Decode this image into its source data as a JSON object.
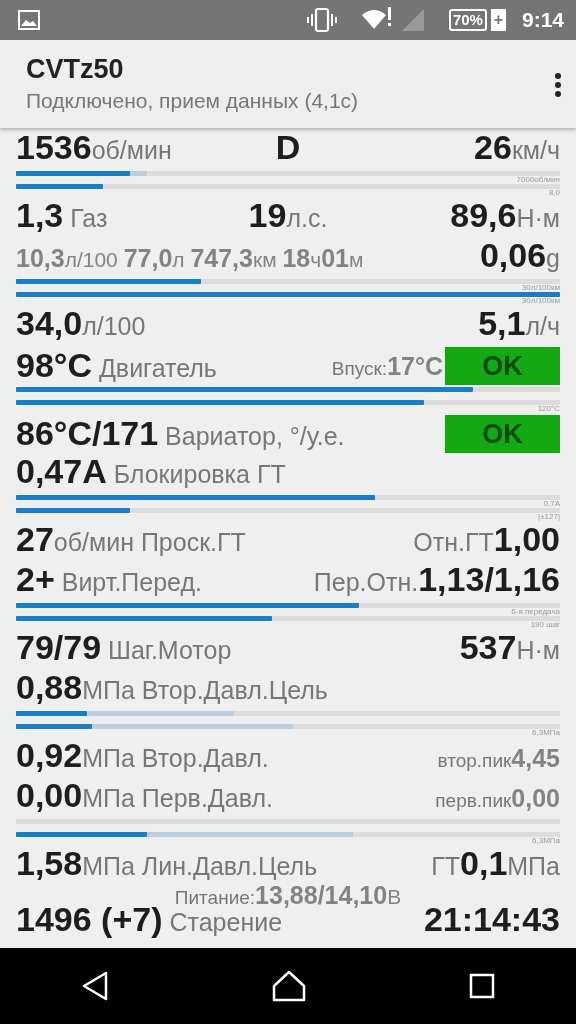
{
  "status_bar": {
    "battery": "70%",
    "battery_plus": "+",
    "time": "9:14"
  },
  "app_bar": {
    "title": "CVTz50",
    "subtitle": "Подключено, прием данных (4,1с)"
  },
  "rows": [
    {
      "kind": "line",
      "left": [
        {
          "kind": "value",
          "text": "1536"
        },
        {
          "kind": "unit",
          "text": "об/мин"
        }
      ],
      "center": [
        {
          "kind": "value",
          "text": "D"
        }
      ],
      "right": [
        {
          "kind": "value",
          "text": "26"
        },
        {
          "kind": "unit",
          "text": "км/ч"
        }
      ]
    },
    {
      "kind": "bars",
      "bars": [
        {
          "level": 0.21,
          "secondary": {
            "level": 0.24
          },
          "caption": "7000об/мин"
        },
        {
          "level": 0.16,
          "caption": "8,0"
        }
      ]
    },
    {
      "kind": "line",
      "left": [
        {
          "kind": "value",
          "text": "1,3"
        },
        {
          "kind": "unit",
          "text": " Газ"
        }
      ],
      "center": [
        {
          "kind": "value",
          "text": "19"
        },
        {
          "kind": "unit",
          "text": "л.с."
        }
      ],
      "right": [
        {
          "kind": "value",
          "text": "89,6"
        },
        {
          "kind": "unit",
          "text": "Н·м"
        }
      ]
    },
    {
      "kind": "line",
      "left": [
        {
          "kind": "gvalue",
          "text": "10,3"
        },
        {
          "kind": "sunit",
          "text": "л/100 "
        },
        {
          "kind": "gvalue",
          "text": "77,0"
        },
        {
          "kind": "sunit",
          "text": "л "
        },
        {
          "kind": "gvalue",
          "text": "747,3"
        },
        {
          "kind": "sunit",
          "text": "км "
        },
        {
          "kind": "gvalue",
          "text": "18"
        },
        {
          "kind": "sunit",
          "text": "ч"
        },
        {
          "kind": "gvalue",
          "text": "01"
        },
        {
          "kind": "sunit",
          "text": "м"
        }
      ],
      "right": [
        {
          "kind": "value",
          "text": "0,06"
        },
        {
          "kind": "unit",
          "text": "g"
        }
      ]
    },
    {
      "kind": "bars",
      "bars": [
        {
          "level": 0.34,
          "caption": "30л/100км"
        },
        {
          "level": 1.0,
          "caption": "30л/100км"
        }
      ]
    },
    {
      "kind": "line",
      "left": [
        {
          "kind": "value",
          "text": "34,0"
        },
        {
          "kind": "unit",
          "text": "л/100"
        }
      ],
      "right": [
        {
          "kind": "value",
          "text": "5,1"
        },
        {
          "kind": "unit",
          "text": "л/ч"
        }
      ]
    },
    {
      "kind": "line",
      "left": [
        {
          "kind": "value",
          "text": "98°C"
        },
        {
          "kind": "unit",
          "text": " Двигатель"
        }
      ],
      "right": [
        {
          "kind": "label",
          "text": "Впуск: "
        },
        {
          "kind": "gvalue",
          "text": "17°C"
        }
      ],
      "badge": {
        "text": "OK",
        "color": "#14a814"
      }
    },
    {
      "kind": "bars",
      "bars": [
        {
          "level": 0.84
        },
        {
          "level": 0.75,
          "caption": "120°C"
        }
      ]
    },
    {
      "kind": "line",
      "left": [
        {
          "kind": "value",
          "text": "86°C/171"
        },
        {
          "kind": "unit",
          "text": " Вариатор, °/у.е."
        }
      ],
      "badge": {
        "text": "OK",
        "color": "#14a814"
      }
    },
    {
      "kind": "line",
      "left": [
        {
          "kind": "value",
          "text": "0,47A"
        },
        {
          "kind": "unit",
          "text": " Блокировка ГТ"
        }
      ]
    },
    {
      "kind": "bars",
      "bars": [
        {
          "level": 0.66,
          "caption": "0,7A"
        },
        {
          "level": 0.21,
          "caption": "|±127|"
        }
      ]
    },
    {
      "kind": "line",
      "left": [
        {
          "kind": "value",
          "text": "27"
        },
        {
          "kind": "unit",
          "text": "об/мин Проск.ГТ"
        }
      ],
      "right": [
        {
          "kind": "unit",
          "text": "Отн.ГТ "
        },
        {
          "kind": "value",
          "text": "1,00"
        }
      ]
    },
    {
      "kind": "line",
      "left": [
        {
          "kind": "value",
          "text": "2+"
        },
        {
          "kind": "unit",
          "text": " Вирт.Перед."
        }
      ],
      "right": [
        {
          "kind": "unit",
          "text": "Пер.Отн."
        },
        {
          "kind": "value",
          "text": "1,13/1,16"
        }
      ]
    },
    {
      "kind": "bars",
      "bars": [
        {
          "level": 0.63,
          "caption": "6-я передача"
        },
        {
          "level": 0.47,
          "caption": "190 шаг"
        }
      ]
    },
    {
      "kind": "line",
      "left": [
        {
          "kind": "value",
          "text": "79/79"
        },
        {
          "kind": "unit",
          "text": " Шаг.Мотор"
        }
      ],
      "right": [
        {
          "kind": "value",
          "text": "537"
        },
        {
          "kind": "unit",
          "text": "Н·м"
        }
      ]
    },
    {
      "kind": "line",
      "left": [
        {
          "kind": "value",
          "text": "0,88"
        },
        {
          "kind": "unit",
          "text": "МПа Втор.Давл.Цель"
        }
      ]
    },
    {
      "kind": "bars",
      "bars": [
        {
          "level": 0.13,
          "secondary": {
            "level": 0.4
          }
        },
        {
          "level": 0.14,
          "secondary": {
            "level": 0.51
          },
          "caption": "6,3МПа"
        }
      ]
    },
    {
      "kind": "line",
      "left": [
        {
          "kind": "value",
          "text": "0,92"
        },
        {
          "kind": "unit",
          "text": "МПа Втор.Давл."
        }
      ],
      "right": [
        {
          "kind": "label",
          "text": "втор.пик "
        },
        {
          "kind": "gvalue",
          "text": "4,45"
        }
      ]
    },
    {
      "kind": "line",
      "left": [
        {
          "kind": "value",
          "text": "0,00"
        },
        {
          "kind": "unit",
          "text": "МПа Перв.Давл."
        }
      ],
      "right": [
        {
          "kind": "label",
          "text": "перв.пик "
        },
        {
          "kind": "gvalue",
          "text": "0,00"
        }
      ]
    },
    {
      "kind": "bars",
      "bars": [
        {
          "kind": "empty_track"
        },
        {
          "kind": "meter",
          "level": 0.24,
          "secondary": {
            "level": 0.62
          },
          "caption": "6,3МПа"
        }
      ]
    },
    {
      "kind": "line",
      "left": [
        {
          "kind": "value",
          "text": "1,58"
        },
        {
          "kind": "unit",
          "text": "МПа Лин.Давл.Цель"
        }
      ],
      "right": [
        {
          "kind": "unit",
          "text": "ГТ "
        },
        {
          "kind": "value",
          "text": "0,1"
        },
        {
          "kind": "unit",
          "text": "МПа"
        }
      ]
    },
    {
      "kind": "small",
      "center": [
        {
          "kind": "label",
          "text": "Питание:"
        },
        {
          "kind": "gvalue",
          "text": "13,88/14,10"
        },
        {
          "kind": "sunit",
          "text": "В"
        }
      ]
    },
    {
      "kind": "line",
      "left": [
        {
          "kind": "value",
          "text": "1496 (+7)"
        },
        {
          "kind": "unit",
          "text": " Старение"
        }
      ],
      "right": [
        {
          "kind": "value",
          "text": "21:14:43"
        }
      ]
    }
  ]
}
